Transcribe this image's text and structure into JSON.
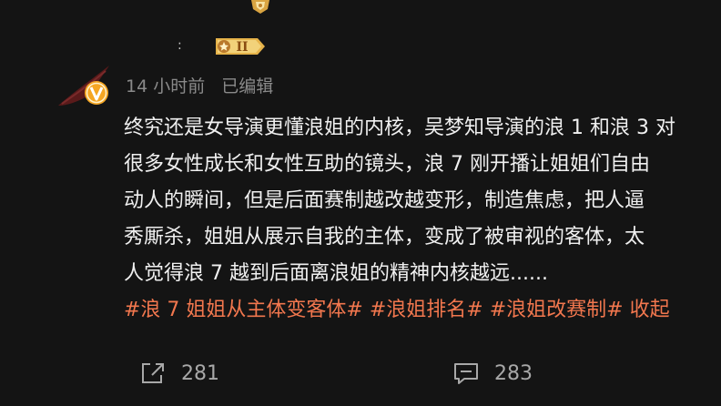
{
  "post": {
    "time": "14 小时前",
    "edited": "已编辑",
    "lines": [
      "终究还是女导演更懂浪姐的内核，吴梦知导演的浪 1 和浪 3 对",
      "很多女性成长和女性互助的镜头，浪 7 刚开播让姐姐们自由",
      "动人的瞬间，但是后面赛制越改越变形，制造焦虑，把人逼",
      "秀厮杀，姐姐从展示自我的主体，变成了被审视的客体，太",
      "人觉得浪 7 越到后面离浪姐的精神内核越远......"
    ],
    "tags": "#浪 7 姐姐从主体变客体#  #浪姐排名#  #浪姐改赛制#  收起"
  },
  "actions": {
    "share_count": "281",
    "comment_count": "283"
  },
  "badges": {
    "level": "II"
  },
  "colors": {
    "background": "#141414",
    "tag": "#f2774e",
    "meta": "#8a8a8a",
    "badge_gold": "#e6b34a",
    "avatar_orange": "#f5a623"
  }
}
